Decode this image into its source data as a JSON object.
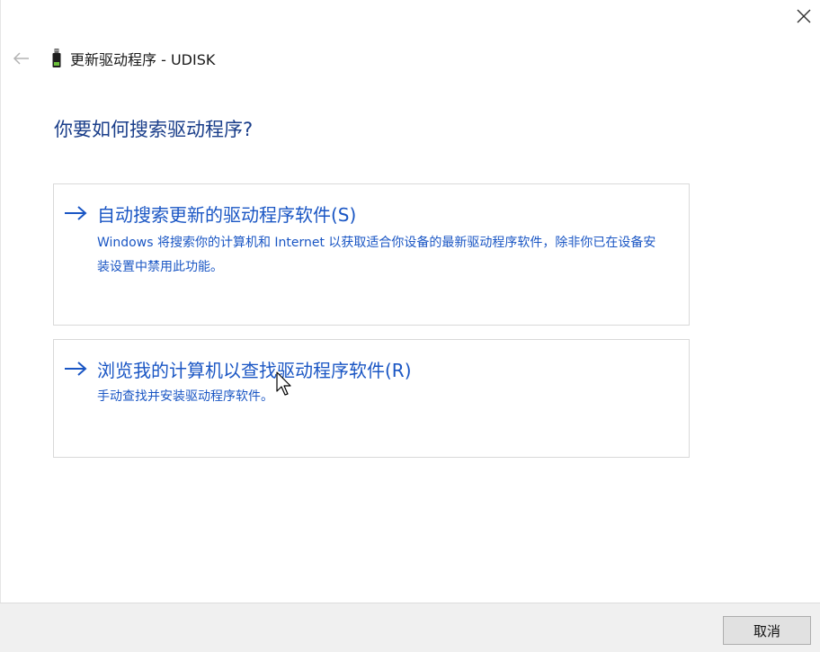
{
  "header": {
    "title": "更新驱动程序 - UDISK"
  },
  "question": "你要如何搜索驱动程序?",
  "options": [
    {
      "title": "自动搜索更新的驱动程序软件(S)",
      "description": "Windows 将搜索你的计算机和 Internet 以获取适合你设备的最新驱动程序软件，除非你已在设备安装设置中禁用此功能。"
    },
    {
      "title": "浏览我的计算机以查找驱动程序软件(R)",
      "description": "手动查找并安装驱动程序软件。"
    }
  ],
  "footer": {
    "cancel_label": "取消"
  },
  "colors": {
    "accent": "#1a56c4",
    "question": "#1a3e8a",
    "footer_bg": "#f0f0f0"
  },
  "icons": {
    "close": "close-icon",
    "back": "back-arrow-icon",
    "device": "usb-drive-icon",
    "option_arrow": "right-arrow-icon"
  }
}
